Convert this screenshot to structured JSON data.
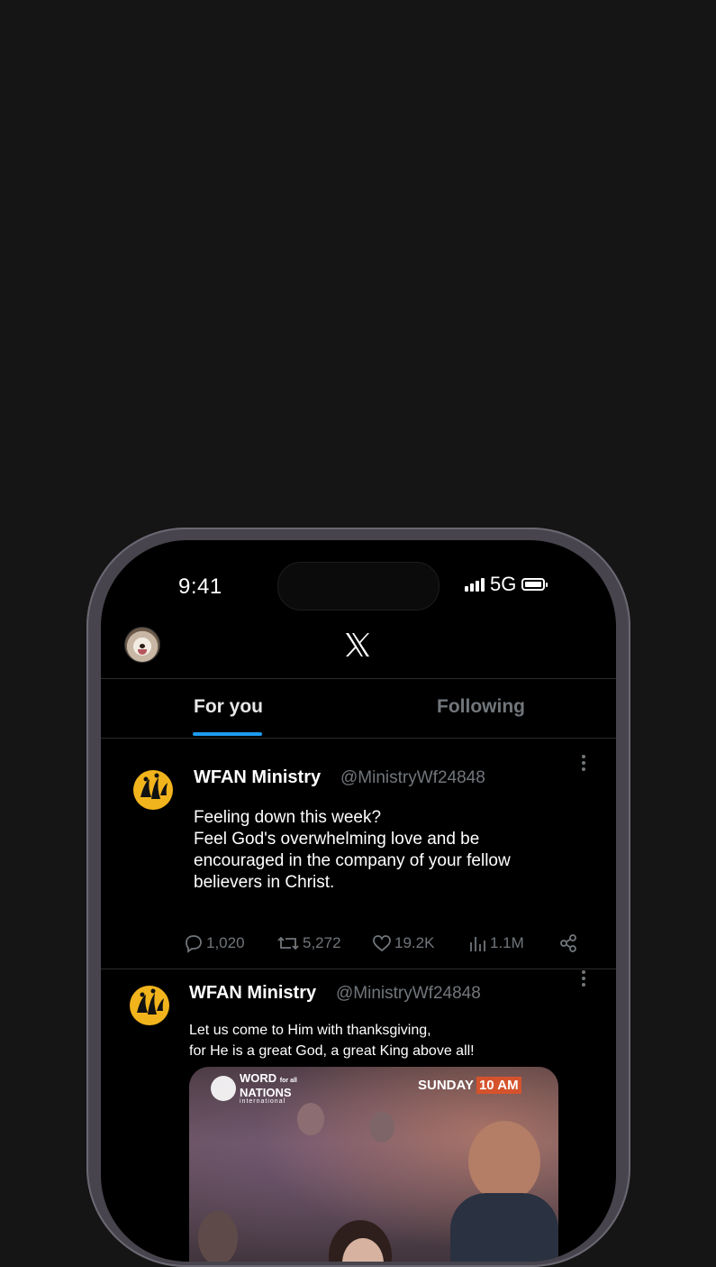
{
  "status_bar": {
    "time": "9:41",
    "network": "5G"
  },
  "header": {
    "logo_icon": "x-logo-icon",
    "avatar_icon": "dog-avatar-icon"
  },
  "tabs": [
    {
      "label": "For you",
      "active": true
    },
    {
      "label": "Following",
      "active": false
    }
  ],
  "accent_color": "#1d9bf0",
  "posts": [
    {
      "author": "WFAN Ministry",
      "handle": "@MinistryWf24848",
      "text_lines": [
        "Feeling down this week?",
        "Feel God's overwhelming love and be",
        "encouraged in the company of your fellow",
        "believers in Christ."
      ],
      "replies": "1,020",
      "reposts": "5,272",
      "likes": "19.2K",
      "views": "1.1M"
    },
    {
      "author": "WFAN Ministry",
      "handle": "@MinistryWf24848",
      "text_lines": [
        "Let us come to Him with thanksgiving,",
        "for He is a great God, a great King above all!"
      ],
      "media": {
        "brand_line1": "WORD",
        "brand_small": "for all",
        "brand_line2": "NATIONS",
        "brand_line3": "international",
        "day": "SUNDAY",
        "time": "10 AM"
      }
    }
  ]
}
